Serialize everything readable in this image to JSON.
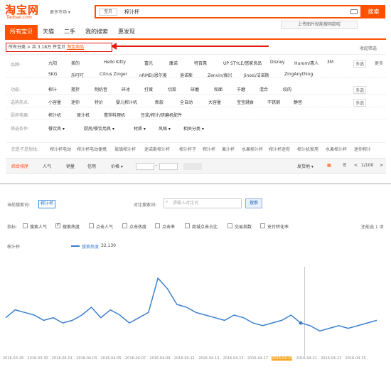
{
  "header": {
    "logo": "淘宝网",
    "logo_sub": "Taobao.com",
    "market": "更多市场",
    "category": "宝贝",
    "query": "榨汁杯",
    "search_button": "搜索",
    "image_tip": "上传图片就能搜同款啦"
  },
  "tabs": [
    "所有宝贝",
    "天猫",
    "二手",
    "我的搜索",
    "惠发现"
  ],
  "breadcrumb": {
    "all": "所有分类",
    "count": "共 3.18万 件宝贝",
    "ad": "淘宝商品"
  },
  "collapse": "收起筛选",
  "brand": {
    "label": "品牌:",
    "row1": [
      "九阳",
      "美的",
      "Hello Kitty",
      "富光",
      "康诺",
      "特百惠",
      "UP STYLE/悠家良品",
      "Disney",
      "Hurom/惠人",
      "3M"
    ],
    "row2": [
      "SKG",
      "乐叮叮",
      "Citrus Zinger",
      "nRMEI/恩尔美",
      "洛诺斯",
      "Zenvin/振兴",
      "Jinosi/洁诺斯",
      "ZingAnything"
    ],
    "multi": "多选",
    "more": "更多"
  },
  "func": {
    "label": "功能:",
    "opts": [
      "榨汁",
      "搅拌",
      "制奶昔",
      "碎冰",
      "打蛋",
      "切菜",
      "研磨",
      "和面",
      "干磨",
      "混合",
      "绞肉"
    ],
    "multi": "多选"
  },
  "tech": {
    "label": "选购热点:",
    "opts": [
      "小容量",
      "迷你",
      "特价",
      "婴儿榨汁机",
      "新款",
      "全自动",
      "大容量",
      "宝宝辅食",
      "不锈钢",
      "静音"
    ],
    "multi": "多选"
  },
  "appliance": {
    "label": "厨房电器:",
    "opts": [
      "榨汁机",
      "原汁机",
      "搅拌料理机",
      "豆浆/榨汁/研磨机配件"
    ]
  },
  "filter": {
    "label": "筛选条件:",
    "opts": [
      "餐饮具",
      "厨房/餐饮用具",
      "材质",
      "风格",
      "相关分类"
    ]
  },
  "suggest": {
    "label": "您是不是想找:",
    "opts": [
      "榨汁杯电动",
      "榨汁杯电动便携",
      "玻璃榨汁杯",
      "迷诺斯榨汁杯",
      "榨汁杯子",
      "榨汁杯",
      "果汁杯",
      "水果榨汁杯",
      "榨汁杯迷你",
      "榨汁机家用",
      "水果榨汁杯",
      "迷你榨汁"
    ]
  },
  "sort": {
    "items": [
      "综合排序",
      "人气",
      "销量",
      "信用",
      "价格"
    ],
    "ship": "发货地",
    "page": "1/100"
  },
  "index": {
    "current_label": "当前搜索词:",
    "keyword": "榨汁杯",
    "compare_label": "对比搜索词:",
    "compare_placeholder": "请输入对比词",
    "search": "搜索",
    "metric_label": "指标:",
    "metrics": [
      "搜索人气",
      "搜索热度",
      "点击人气",
      "点击热度",
      "点击率",
      "商城点击占比",
      "交易指数",
      "支付转化率"
    ],
    "checked": [
      false,
      true,
      false,
      false,
      false,
      false,
      false,
      false
    ],
    "note": "还能选 1 项",
    "series_label": "榨汁杯",
    "legend": "搜索热度",
    "legend_value": "32,130"
  },
  "chart_data": {
    "type": "line",
    "series": [
      {
        "name": "搜索热度",
        "values": [
          33,
          36,
          35,
          34,
          32,
          33,
          31,
          32,
          34,
          37,
          33,
          36,
          34,
          31,
          33,
          35,
          48,
          44,
          38,
          37,
          35,
          34,
          33,
          32,
          34,
          33,
          31,
          30,
          31,
          32,
          34,
          31,
          30,
          28,
          29,
          30,
          29,
          30,
          31,
          32
        ]
      }
    ],
    "ticks": [
      "2016-03-28",
      "2016-03-30",
      "2016-04-01",
      "2016-04-03",
      "2016-04-05",
      "2016-04-07",
      "2016-04-09",
      "2016-04-11",
      "2016-04-13",
      "2016-04-15",
      "2016-04-17",
      "2016-04-19",
      "2016-04-21",
      "2016-04-23",
      "2016-04-25"
    ],
    "highlight_tick": 11
  },
  "colors": {
    "accent": "#ff5000",
    "line": "#3c7fd0",
    "highlight": "#f5a623"
  }
}
